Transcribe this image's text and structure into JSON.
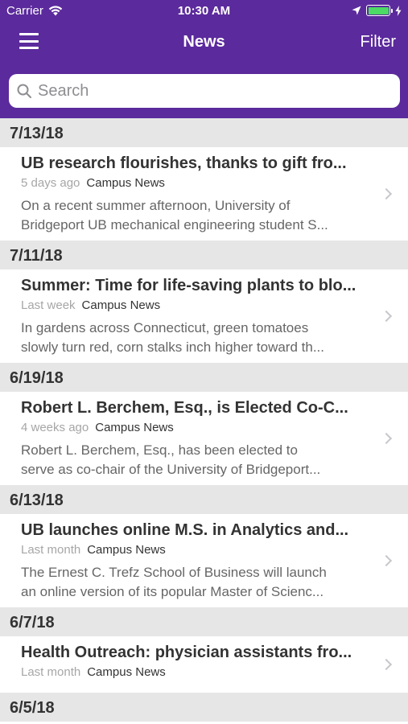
{
  "status_bar": {
    "carrier": "Carrier",
    "time": "10:30 AM"
  },
  "navbar": {
    "title": "News",
    "filter_label": "Filter"
  },
  "search": {
    "placeholder": "Search"
  },
  "colors": {
    "header_purple": "#5b2a9c",
    "section_gray": "#e6e6e6",
    "battery_green": "#4cd964"
  },
  "sections": [
    {
      "date": "7/13/18",
      "item": {
        "title": "UB research flourishes, thanks to gift fro...",
        "ago": "5 days ago",
        "source": "Campus News",
        "summary_line1": "On a recent summer afternoon, University of",
        "summary_line2": "Bridgeport UB mechanical engineering student S..."
      }
    },
    {
      "date": "7/11/18",
      "item": {
        "title": "Summer: Time for life-saving plants to blo...",
        "ago": "Last week",
        "source": "Campus News",
        "summary_line1": "In gardens across Connecticut, green tomatoes",
        "summary_line2": "slowly turn red, corn stalks inch higher toward th..."
      }
    },
    {
      "date": "6/19/18",
      "item": {
        "title": "Robert L. Berchem, Esq., is Elected Co-C...",
        "ago": "4 weeks ago",
        "source": "Campus News",
        "summary_line1": "Robert L. Berchem, Esq., has been elected to",
        "summary_line2": "serve as co-chair of the University of Bridgeport..."
      }
    },
    {
      "date": "6/13/18",
      "item": {
        "title": "UB launches online M.S. in Analytics and...",
        "ago": "Last month",
        "source": "Campus News",
        "summary_line1": "The Ernest C. Trefz School of Business will launch",
        "summary_line2": "an online version of its popular Master of Scienc..."
      }
    },
    {
      "date": "6/7/18",
      "item": {
        "title": "Health Outreach: physician assistants fro...",
        "ago": "Last month",
        "source": "Campus News"
      }
    },
    {
      "date": "6/5/18"
    }
  ]
}
